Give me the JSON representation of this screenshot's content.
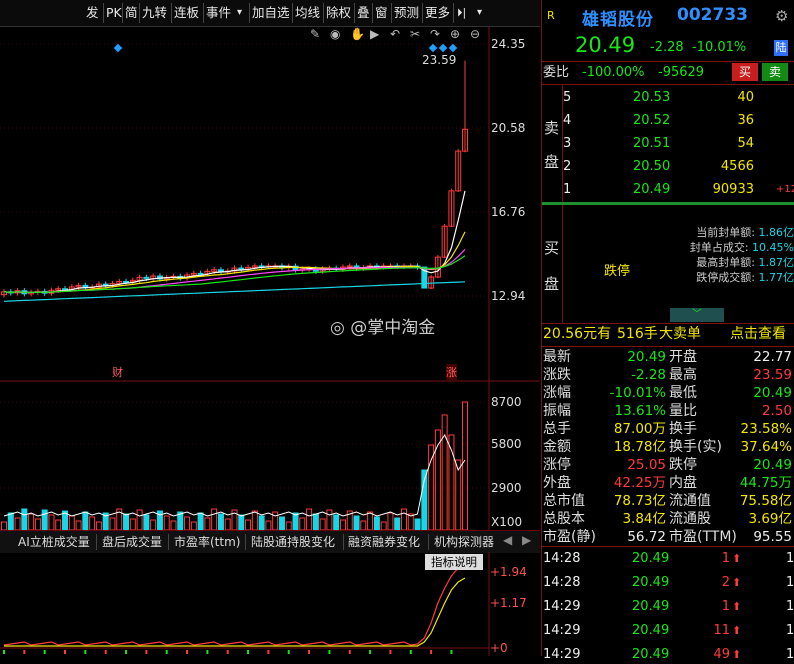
{
  "toolbar": {
    "items": [
      "发",
      "PK",
      "简",
      "九转",
      "连板",
      "事件",
      "▾",
      "加自选",
      "均线",
      "除权",
      "叠",
      "窗",
      "预测",
      "更多",
      "⏵|",
      "▾"
    ]
  },
  "chart": {
    "price_labels": [
      "24.35",
      "20.58",
      "16.76",
      "12.94"
    ],
    "high_label": "23.59",
    "marker_cai": "财",
    "marker_zhang": "涨",
    "volume_labels": [
      "8700",
      "5800",
      "2900",
      "X100"
    ],
    "indicator_labels": [
      "+1.94",
      "+1.17",
      "+0"
    ],
    "indicator_tabs": [
      "AI立桩成交量",
      "盘后成交量",
      "市盈率(ttm)",
      "陆股通持股变化",
      "融资融券变化",
      "机构探测器"
    ],
    "indicator_explain": "指标说明",
    "watermark": "@掌中淘金",
    "colors": {
      "up": "#ff3b3b",
      "down": "#19d6e6",
      "ma5": "#ffffff",
      "ma10": "#f2e600",
      "ma20": "#ff44ff",
      "ma30": "#19e619",
      "ma60": "#19d6e6"
    }
  },
  "chart_data": {
    "type": "candlestick",
    "ylim": [
      12.94,
      24.35
    ],
    "price_ticks": [
      24.35,
      20.58,
      16.76,
      12.94
    ],
    "last_candles_close": [
      13.3,
      13.8,
      14.7,
      16.1,
      17.7,
      19.5,
      20.49
    ],
    "day_high": 23.59,
    "volume_ticks": [
      8700,
      5800,
      2900
    ],
    "indicator_ticks": [
      1.94,
      1.17,
      0
    ]
  },
  "quote": {
    "flag": "R",
    "name": "雄韬股份",
    "code": "002733",
    "price": "20.49",
    "change": "-2.28",
    "pct": "-10.01%",
    "exchange_badge": "陆",
    "weibi_label": "委比",
    "weibi_pct": "-100.00%",
    "weicha": "-95629",
    "buy_btn": "买",
    "sell_btn": "卖"
  },
  "sell_book": {
    "side_label": [
      "卖",
      "盘"
    ],
    "rows": [
      {
        "lvl": "5",
        "price": "20.53",
        "vol": "40",
        "chg": ""
      },
      {
        "lvl": "4",
        "price": "20.52",
        "vol": "36",
        "chg": ""
      },
      {
        "lvl": "3",
        "price": "20.51",
        "vol": "54",
        "chg": ""
      },
      {
        "lvl": "2",
        "price": "20.50",
        "vol": "4566",
        "chg": ""
      },
      {
        "lvl": "1",
        "price": "20.49",
        "vol": "90933",
        "chg": "+12"
      }
    ]
  },
  "buy_book": {
    "side_label": [
      "买",
      "盘"
    ],
    "status": "跌停",
    "info": [
      {
        "label": "当前封单额:",
        "value": "1.86亿"
      },
      {
        "label": "封单占成交:",
        "value": "10.45%"
      },
      {
        "label": "最高封单额:",
        "value": "1.87亿"
      },
      {
        "label": "跌停成交额:",
        "value": "1.77亿"
      }
    ]
  },
  "big_order": {
    "price": "20.56元有",
    "vol": "516手",
    "type": "大卖单",
    "link": "点击查看"
  },
  "stats": [
    {
      "l1": "最新",
      "v1": "20.49",
      "c1": "green",
      "l2": "开盘",
      "v2": "22.77",
      "c2": "white"
    },
    {
      "l1": "涨跌",
      "v1": "-2.28",
      "c1": "green",
      "l2": "最高",
      "v2": "23.59",
      "c2": "red"
    },
    {
      "l1": "涨幅",
      "v1": "-10.01%",
      "c1": "green",
      "l2": "最低",
      "v2": "20.49",
      "c2": "green"
    },
    {
      "l1": "振幅",
      "v1": "13.61%",
      "c1": "green",
      "l2": "量比",
      "v2": "2.50",
      "c2": "red"
    },
    {
      "l1": "总手",
      "v1": "87.00万",
      "c1": "yellow",
      "l2": "换手",
      "v2": "23.58%",
      "c2": "yellow"
    },
    {
      "l1": "金额",
      "v1": "18.78亿",
      "c1": "yellow",
      "l2": "换手(实)",
      "v2": "37.64%",
      "c2": "yellow"
    },
    {
      "l1": "涨停",
      "v1": "25.05",
      "c1": "red",
      "l2": "跌停",
      "v2": "20.49",
      "c2": "green"
    },
    {
      "l1": "外盘",
      "v1": "42.25万",
      "c1": "red",
      "l2": "内盘",
      "v2": "44.75万",
      "c2": "green"
    },
    {
      "l1": "总市值",
      "v1": "78.73亿",
      "c1": "yellow",
      "l2": "流通值",
      "v2": "75.58亿",
      "c2": "yellow"
    },
    {
      "l1": "总股本",
      "v1": "3.84亿",
      "c1": "yellow",
      "l2": "流通股",
      "v2": "3.69亿",
      "c2": "yellow"
    },
    {
      "l1": "市盈(静)",
      "v1": "56.72",
      "c1": "white",
      "l2": "市盈(TTM)",
      "v2": "95.55",
      "c2": "white"
    }
  ],
  "ticks": [
    {
      "time": "14:28",
      "price": "20.49",
      "vol": "1",
      "tail": "1"
    },
    {
      "time": "14:28",
      "price": "20.49",
      "vol": "2",
      "tail": "1"
    },
    {
      "time": "14:29",
      "price": "20.49",
      "vol": "1",
      "tail": "1"
    },
    {
      "time": "14:29",
      "price": "20.49",
      "vol": "11",
      "tail": "1"
    },
    {
      "time": "14:29",
      "price": "20.49",
      "vol": "49",
      "tail": "1"
    }
  ]
}
